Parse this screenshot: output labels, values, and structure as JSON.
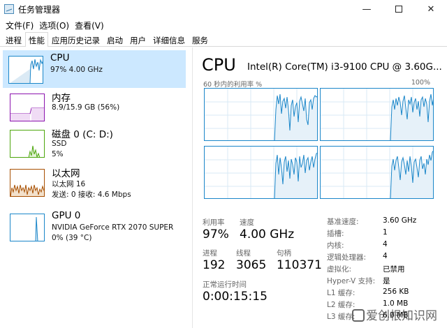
{
  "window": {
    "title": "任务管理器",
    "controls": [
      "minimize-icon",
      "maximize-icon",
      "close-icon"
    ]
  },
  "menu": [
    "文件(F)",
    "选项(O)",
    "查看(V)"
  ],
  "tabs": [
    "进程",
    "性能",
    "应用历史记录",
    "启动",
    "用户",
    "详细信息",
    "服务"
  ],
  "active_tab": "性能",
  "sidebar": [
    {
      "name": "CPU",
      "sub1": "97%  4.00 GHz",
      "color": "#1a86c9",
      "selected": true
    },
    {
      "name": "内存",
      "sub1": "8.9/15.9 GB (56%)",
      "color": "#8b12ae"
    },
    {
      "name": "磁盘 0 (C: D:)",
      "sub1": "SSD",
      "sub2": "5%",
      "color": "#4da60c"
    },
    {
      "name": "以太网",
      "sub1": "以太网 16",
      "sub2": "发送: 0 接收: 4.6 Mbps",
      "color": "#a74f01"
    },
    {
      "name": "GPU 0",
      "sub1": "NVIDIA GeForce RTX 2070 SUPER",
      "sub2": "0% (39 °C)",
      "color": "#1a86c9"
    }
  ],
  "main": {
    "title": "CPU",
    "model": "Intel(R) Core(TM) i3-9100 CPU @ 3.60G...",
    "graph_label": "60 秒内的利用率 %",
    "graph_max": "100%",
    "utilization_label": "利用率",
    "utilization": "97%",
    "speed_label": "速度",
    "speed": "4.00 GHz",
    "processes_label": "进程",
    "processes": "192",
    "threads_label": "线程",
    "threads": "3065",
    "handles_label": "句柄",
    "handles": "110371",
    "uptime_label": "正常运行时间",
    "uptime": "0:00:15:15",
    "specs": [
      {
        "k": "基准速度:",
        "v": "3.60 GHz"
      },
      {
        "k": "插槽:",
        "v": "1"
      },
      {
        "k": "内核:",
        "v": "4"
      },
      {
        "k": "逻辑处理器:",
        "v": "4"
      },
      {
        "k": "虚拟化:",
        "v": "已禁用"
      },
      {
        "k": "Hyper-V 支持:",
        "v": "是"
      },
      {
        "k": "L1 缓存:",
        "v": "256 KB"
      },
      {
        "k": "L2 缓存:",
        "v": "1.0 MB"
      },
      {
        "k": "L3 缓存:",
        "v": "6.0 MB"
      }
    ]
  },
  "watermark": "爱创根知识网"
}
